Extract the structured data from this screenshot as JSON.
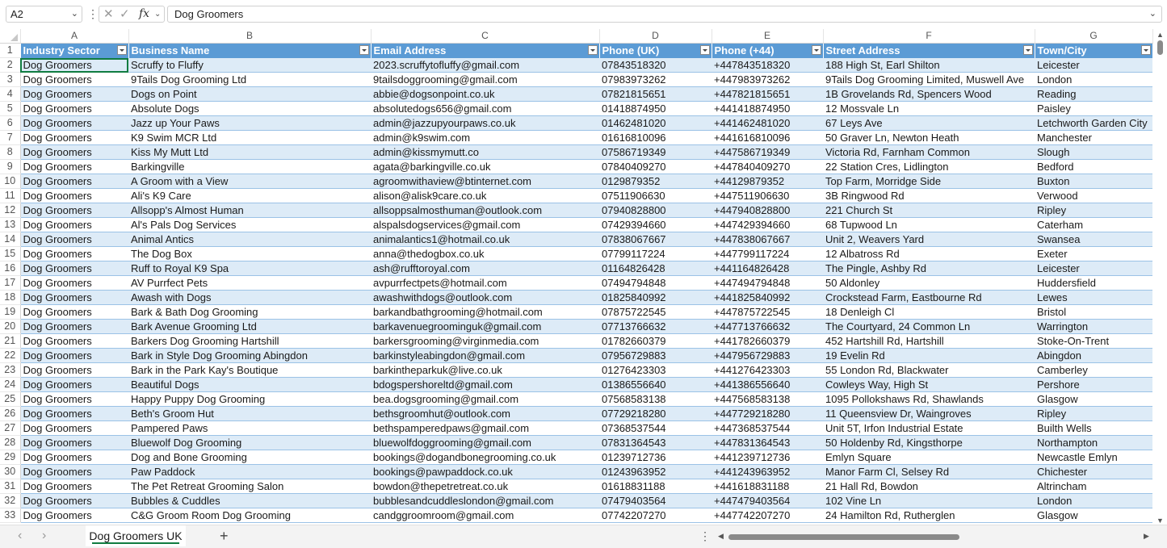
{
  "formula_bar": {
    "name_box": "A2",
    "formula": "Dog Groomers",
    "fx_label": "fx",
    "cancel_glyph": "✕",
    "enter_glyph": "✓",
    "more_glyph": "⋮"
  },
  "columns": [
    "A",
    "B",
    "C",
    "D",
    "E",
    "F",
    "G"
  ],
  "headers": [
    "Industry Sector",
    "Business Name",
    "Email Address",
    "Phone (UK)",
    "Phone (+44)",
    "Street Address",
    "Town/City"
  ],
  "rows": [
    {
      "n": "2",
      "c": [
        "Dog Groomers",
        "Scruffy to Fluffy",
        "2023.scruffytofluffy@gmail.com",
        "07843518320",
        "+447843518320",
        "188 High St, Earl Shilton",
        "Leicester"
      ]
    },
    {
      "n": "3",
      "c": [
        "Dog Groomers",
        "9Tails Dog Grooming Ltd",
        "9tailsdoggrooming@gmail.com",
        "07983973262",
        "+447983973262",
        "9Tails Dog Grooming Limited, Muswell Ave",
        "London"
      ]
    },
    {
      "n": "4",
      "c": [
        "Dog Groomers",
        "Dogs on Point",
        "abbie@dogsonpoint.co.uk",
        "07821815651",
        "+447821815651",
        "1B Grovelands Rd, Spencers Wood",
        "Reading"
      ]
    },
    {
      "n": "5",
      "c": [
        "Dog Groomers",
        "Absolute Dogs",
        "absolutedogs656@gmail.com",
        "01418874950",
        "+441418874950",
        "12 Mossvale Ln",
        "Paisley"
      ]
    },
    {
      "n": "6",
      "c": [
        "Dog Groomers",
        "Jazz up Your Paws",
        "admin@jazzupyourpaws.co.uk",
        "01462481020",
        "+441462481020",
        "67 Leys Ave",
        "Letchworth Garden City"
      ]
    },
    {
      "n": "7",
      "c": [
        "Dog Groomers",
        "K9 Swim MCR Ltd",
        "admin@k9swim.com",
        "01616810096",
        "+441616810096",
        "50 Graver Ln, Newton Heath",
        "Manchester"
      ]
    },
    {
      "n": "8",
      "c": [
        "Dog Groomers",
        "Kiss My Mutt Ltd",
        "admin@kissmymutt.co",
        "07586719349",
        "+447586719349",
        "Victoria Rd, Farnham Common",
        "Slough"
      ]
    },
    {
      "n": "9",
      "c": [
        "Dog Groomers",
        "Barkingville",
        "agata@barkingville.co.uk",
        "07840409270",
        "+447840409270",
        "22 Station Cres, Lidlington",
        "Bedford"
      ]
    },
    {
      "n": "10",
      "c": [
        "Dog Groomers",
        "A Groom with a View",
        "agroomwithaview@btinternet.com",
        "0129879352",
        "+44129879352",
        "Top Farm, Morridge Side",
        "Buxton"
      ]
    },
    {
      "n": "11",
      "c": [
        "Dog Groomers",
        "Ali's K9 Care",
        "alison@alisk9care.co.uk",
        "07511906630",
        "+447511906630",
        "3B Ringwood Rd",
        "Verwood"
      ]
    },
    {
      "n": "12",
      "c": [
        "Dog Groomers",
        "Allsopp's Almost Human",
        "allsoppsalmosthuman@outlook.com",
        "07940828800",
        "+447940828800",
        "221 Church St",
        "Ripley"
      ]
    },
    {
      "n": "13",
      "c": [
        "Dog Groomers",
        "Al's Pals Dog Services",
        "alspalsdogservices@gmail.com",
        "07429394660",
        "+447429394660",
        "68 Tupwood Ln",
        "Caterham"
      ]
    },
    {
      "n": "14",
      "c": [
        "Dog Groomers",
        "Animal Antics",
        "animalantics1@hotmail.co.uk",
        "07838067667",
        "+447838067667",
        "Unit 2, Weavers Yard",
        "Swansea"
      ]
    },
    {
      "n": "15",
      "c": [
        "Dog Groomers",
        "The Dog Box",
        "anna@thedogbox.co.uk",
        "07799117224",
        "+447799117224",
        "12 Albatross Rd",
        "Exeter"
      ]
    },
    {
      "n": "16",
      "c": [
        "Dog Groomers",
        "Ruff to Royal K9 Spa",
        "ash@rufftoroyal.com",
        "01164826428",
        "+441164826428",
        "The Pingle, Ashby Rd",
        "Leicester"
      ]
    },
    {
      "n": "17",
      "c": [
        "Dog Groomers",
        "AV Purrfect Pets",
        "avpurrfectpets@hotmail.com",
        "07494794848",
        "+447494794848",
        "50 Aldonley",
        "Huddersfield"
      ]
    },
    {
      "n": "18",
      "c": [
        "Dog Groomers",
        "Awash with Dogs",
        "awashwithdogs@outlook.com",
        "01825840992",
        "+441825840992",
        "Crockstead Farm, Eastbourne Rd",
        "Lewes"
      ]
    },
    {
      "n": "19",
      "c": [
        "Dog Groomers",
        "Bark & Bath Dog Grooming",
        "barkandbathgrooming@hotmail.com",
        "07875722545",
        "+447875722545",
        "18 Denleigh Cl",
        "Bristol"
      ]
    },
    {
      "n": "20",
      "c": [
        "Dog Groomers",
        "Bark Avenue Grooming Ltd",
        "barkavenuegroominguk@gmail.com",
        "07713766632",
        "+447713766632",
        "The Courtyard, 24 Common Ln",
        "Warrington"
      ]
    },
    {
      "n": "21",
      "c": [
        "Dog Groomers",
        "Barkers Dog Grooming Hartshill",
        "barkersgrooming@virginmedia.com",
        "01782660379",
        "+441782660379",
        "452 Hartshill Rd, Hartshill",
        "Stoke-On-Trent"
      ]
    },
    {
      "n": "22",
      "c": [
        "Dog Groomers",
        "Bark in Style Dog Grooming Abingdon",
        "barkinstyleabingdon@gmail.com",
        "07956729883",
        "+447956729883",
        "19 Evelin Rd",
        "Abingdon"
      ]
    },
    {
      "n": "23",
      "c": [
        "Dog Groomers",
        "Bark in the Park Kay's Boutique",
        "barkintheparkuk@live.co.uk",
        "01276423303",
        "+441276423303",
        "55 London Rd, Blackwater",
        "Camberley"
      ]
    },
    {
      "n": "24",
      "c": [
        "Dog Groomers",
        "Beautiful Dogs",
        "bdogspershoreltd@gmail.com",
        "01386556640",
        "+441386556640",
        "Cowleys Way, High St",
        "Pershore"
      ]
    },
    {
      "n": "25",
      "c": [
        "Dog Groomers",
        "Happy Puppy Dog Grooming",
        "bea.dogsgrooming@gmail.com",
        "07568583138",
        "+447568583138",
        "1095 Pollokshaws Rd, Shawlands",
        "Glasgow"
      ]
    },
    {
      "n": "26",
      "c": [
        "Dog Groomers",
        "Beth's Groom Hut",
        "bethsgroomhut@outlook.com",
        "07729218280",
        "+447729218280",
        "11 Queensview Dr, Waingroves",
        "Ripley"
      ]
    },
    {
      "n": "27",
      "c": [
        "Dog Groomers",
        "Pampered Paws",
        "bethspamperedpaws@gmail.com",
        "07368537544",
        "+447368537544",
        "Unit 5T, Irfon Industrial Estate",
        "Builth Wells"
      ]
    },
    {
      "n": "28",
      "c": [
        "Dog Groomers",
        "Bluewolf Dog Grooming",
        "bluewolfdoggrooming@gmail.com",
        "07831364543",
        "+447831364543",
        "50 Holdenby Rd, Kingsthorpe",
        "Northampton"
      ]
    },
    {
      "n": "29",
      "c": [
        "Dog Groomers",
        "Dog and Bone Grooming",
        "bookings@dogandbonegrooming.co.uk",
        "01239712736",
        "+441239712736",
        "Emlyn Square",
        "Newcastle Emlyn"
      ]
    },
    {
      "n": "30",
      "c": [
        "Dog Groomers",
        "Paw Paddock",
        "bookings@pawpaddock.co.uk",
        "01243963952",
        "+441243963952",
        "Manor Farm Cl, Selsey Rd",
        "Chichester"
      ]
    },
    {
      "n": "31",
      "c": [
        "Dog Groomers",
        "The Pet Retreat Grooming Salon",
        "bowdon@thepetretreat.co.uk",
        "01618831188",
        "+441618831188",
        "21 Hall Rd, Bowdon",
        "Altrincham"
      ]
    },
    {
      "n": "32",
      "c": [
        "Dog Groomers",
        "Bubbles & Cuddles",
        "bubblesandcuddleslondon@gmail.com",
        "07479403564",
        "+447479403564",
        "102 Vine Ln",
        "London"
      ]
    },
    {
      "n": "33",
      "c": [
        "Dog Groomers",
        "C&G Groom Room Dog Grooming",
        "candggroomroom@gmail.com",
        "07742207270",
        "+447742207270",
        "24 Hamilton Rd, Rutherglen",
        "Glasgow"
      ]
    }
  ],
  "sheet": {
    "active_tab": "Dog Groomers UK",
    "add_glyph": "+",
    "prev_glyph": "‹",
    "next_glyph": "›"
  },
  "colors": {
    "header_fill": "#5b9bd5",
    "band_fill": "#ddebf7",
    "accent": "#107c41"
  }
}
